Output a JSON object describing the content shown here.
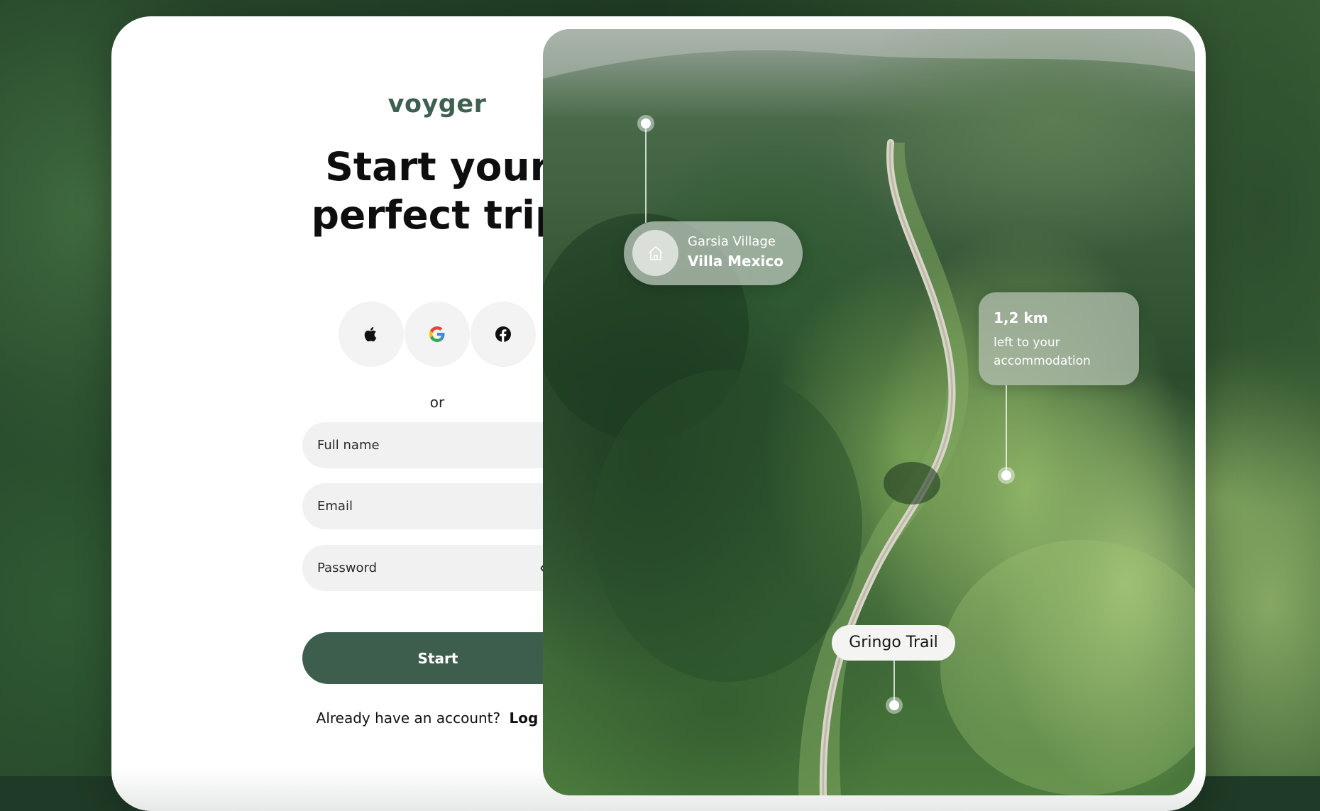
{
  "brand": {
    "logo": "voyger"
  },
  "hero": {
    "line1": "Start  your",
    "line2": "perfect trip"
  },
  "social": {
    "apple_icon": "apple-icon",
    "google_icon": "google-icon",
    "facebook_icon": "facebook-icon"
  },
  "divider": {
    "or_text": "or"
  },
  "form": {
    "full_name": {
      "placeholder": "Full name",
      "value": ""
    },
    "email": {
      "placeholder": "Email",
      "value": ""
    },
    "password": {
      "placeholder": "Password",
      "value": "",
      "toggle_icon": "eye-icon"
    },
    "submit_label": "Start"
  },
  "footer": {
    "prompt": "Already have an account?",
    "login_label": "Log in"
  },
  "map_overlay": {
    "village": {
      "subtitle": "Garsia Village",
      "title": "Villa Mexico",
      "icon": "home-icon"
    },
    "distance": {
      "value": "1,2 km",
      "description": "left to your accommodation"
    },
    "trail": {
      "label": "Gringo Trail"
    }
  },
  "colors": {
    "brand_green": "#3e5e4d",
    "logo_green": "#3f5f51",
    "field_bg": "#f1f1f1"
  }
}
